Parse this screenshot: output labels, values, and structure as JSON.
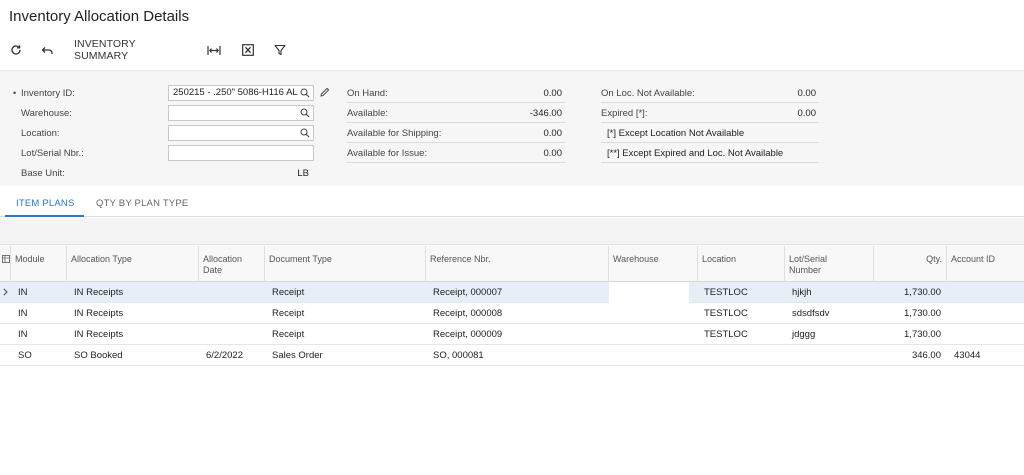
{
  "title": "Inventory Allocation Details",
  "toolbar": {
    "refresh_icon": "refresh-icon",
    "undo_icon": "undo-icon",
    "summary_label": "INVENTORY SUMMARY",
    "fit_icon": "fit-columns-icon",
    "excel_icon": "excel-export-icon",
    "filter_icon": "filter-icon"
  },
  "form": {
    "inventory_id": {
      "label": "Inventory ID:",
      "required_mark": "•",
      "value": "250215 - .250\" 5086-H116 AL"
    },
    "warehouse": {
      "label": "Warehouse:",
      "value": ""
    },
    "location": {
      "label": "Location:",
      "value": ""
    },
    "lot_serial": {
      "label": "Lot/Serial Nbr.:",
      "value": ""
    },
    "base_unit": {
      "label": "Base Unit:",
      "value": "LB"
    },
    "on_hand": {
      "label": "On Hand:",
      "value": "0.00"
    },
    "available": {
      "label": "Available:",
      "value": "-346.00"
    },
    "available_shipping": {
      "label": "Available for Shipping:",
      "value": "0.00"
    },
    "available_issue": {
      "label": "Available for Issue:",
      "value": "0.00"
    },
    "on_loc_not_available": {
      "label": "On Loc. Not Available:",
      "value": "0.00"
    },
    "expired": {
      "label": "Expired [*]:",
      "value": "0.00"
    },
    "note1": "[*]  Except Location Not Available",
    "note2": "[**] Except Expired and  Loc. Not Available"
  },
  "tabs": [
    {
      "label": "ITEM PLANS",
      "active": true
    },
    {
      "label": "QTY BY PLAN TYPE",
      "active": false
    }
  ],
  "grid": {
    "columns": {
      "module": "Module",
      "allocation_type": "Allocation Type",
      "allocation_date_1": "Allocation",
      "allocation_date_2": "Date",
      "document_type": "Document Type",
      "reference_nbr": "Reference Nbr.",
      "warehouse": "Warehouse",
      "location": "Location",
      "lot_serial_1": "Lot/Serial",
      "lot_serial_2": "Number",
      "qty": "Qty.",
      "account_id": "Account ID"
    },
    "rows": [
      {
        "module": "IN",
        "allocation_type": "IN Receipts",
        "allocation_date": "",
        "document_type": "Receipt",
        "reference_nbr": "Receipt, 000007",
        "warehouse": "",
        "location": "TESTLOC",
        "lot_serial": "hjkjh",
        "qty": "1,730.00",
        "account_id": ""
      },
      {
        "module": "IN",
        "allocation_type": "IN Receipts",
        "allocation_date": "",
        "document_type": "Receipt",
        "reference_nbr": "Receipt, 000008",
        "warehouse": "",
        "location": "TESTLOC",
        "lot_serial": "sdsdfsdv",
        "qty": "1,730.00",
        "account_id": ""
      },
      {
        "module": "IN",
        "allocation_type": "IN Receipts",
        "allocation_date": "",
        "document_type": "Receipt",
        "reference_nbr": "Receipt, 000009",
        "warehouse": "",
        "location": "TESTLOC",
        "lot_serial": "jdggg",
        "qty": "1,730.00",
        "account_id": ""
      },
      {
        "module": "SO",
        "allocation_type": "SO Booked",
        "allocation_date": "6/2/2022",
        "document_type": "Sales Order",
        "reference_nbr": "SO, 000081",
        "warehouse": "",
        "location": "",
        "lot_serial": "",
        "qty": "346.00",
        "account_id": "43044"
      }
    ]
  },
  "colors": {
    "accent": "#2b74c7",
    "selected_row": "#e6eef8"
  }
}
